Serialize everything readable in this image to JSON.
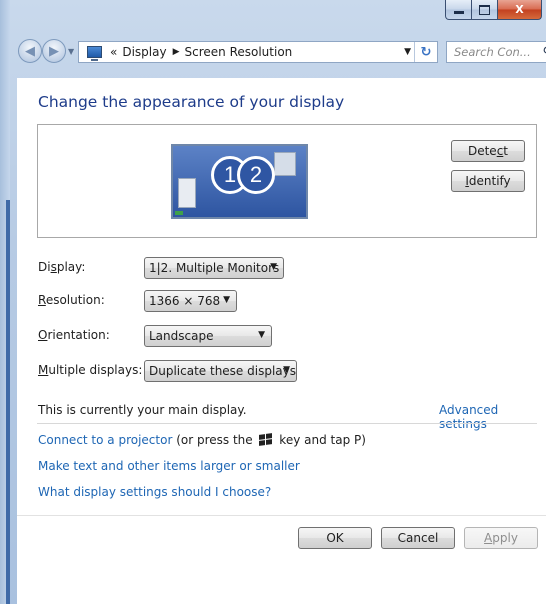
{
  "window": {
    "caption_buttons": {
      "minimize": "minimize-icon",
      "maximize": "maximize-icon",
      "close": "X"
    }
  },
  "nav": {
    "overflow": "«",
    "breadcrumb": [
      "Display",
      "Screen Resolution"
    ],
    "search_placeholder": "Search Con...",
    "refresh_glyph": "↻"
  },
  "main": {
    "title": "Change the appearance of your display",
    "preview": {
      "monitor_1": "1",
      "monitor_2": "2"
    },
    "detect_label": {
      "before": "Dete",
      "underline": "c",
      "after": "t"
    },
    "identify_label": {
      "underline": "I",
      "after": "dentify"
    },
    "fields": {
      "display": {
        "label_before": "Di",
        "label_underline": "s",
        "label_after": "play:",
        "value": "1|2. Multiple Monitors"
      },
      "resolution": {
        "label_underline": "R",
        "label_after": "esolution:",
        "value": "1366 × 768"
      },
      "orientation": {
        "label_underline": "O",
        "label_after": "rientation:",
        "value": "Landscape"
      },
      "multiple": {
        "label_underline": "M",
        "label_after": "ultiple displays:",
        "value": "Duplicate these displays"
      }
    },
    "status_text": "This is currently your main display.",
    "advanced_link": "Advanced settings",
    "projector_link": "Connect to a projector",
    "projector_hint_before": " (or press the ",
    "projector_hint_after": " key and tap P)",
    "text_size_link": "Make text and other items larger or smaller",
    "help_link": "What display settings should I choose?"
  },
  "footer": {
    "ok_label": "OK",
    "cancel_label": "Cancel",
    "apply_label": {
      "underline": "A",
      "after": "pply"
    }
  },
  "colors": {
    "link": "#1e66b4",
    "title": "#1e3c8a",
    "frame": "#b7cbe4"
  }
}
